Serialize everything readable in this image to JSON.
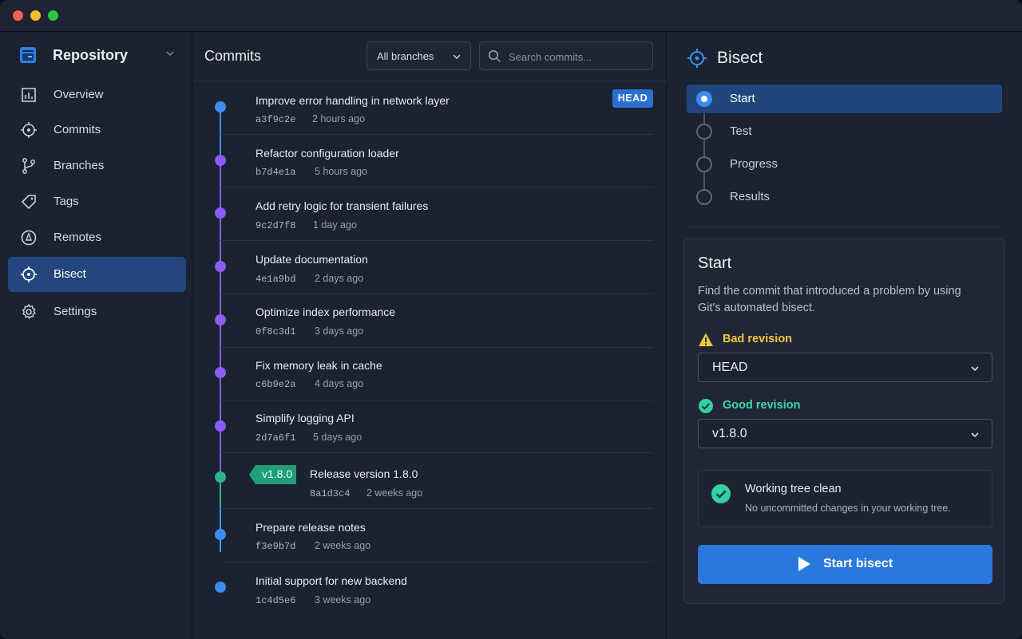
{
  "window": {
    "controls": [
      "close",
      "minimize",
      "maximize"
    ]
  },
  "sidebar": {
    "repo_title": "Repository",
    "repo_icon": "repository-icon",
    "items": [
      {
        "label": "Overview",
        "icon": "overview-icon",
        "active": false
      },
      {
        "label": "Commits",
        "icon": "commits-icon",
        "active": false
      },
      {
        "label": "Branches",
        "icon": "branches-icon",
        "active": false
      },
      {
        "label": "Tags",
        "icon": "tag-icon",
        "active": false
      },
      {
        "label": "Remotes",
        "icon": "remotes-icon",
        "active": false
      },
      {
        "label": "Bisect",
        "icon": "bisect-icon",
        "active": true
      },
      {
        "label": "Settings",
        "icon": "gear-icon",
        "active": false
      }
    ]
  },
  "commits": {
    "title": "Commits",
    "branch_filter": "All branches",
    "search_placeholder": "Search commits...",
    "head_badge": "HEAD",
    "list": [
      {
        "message": "Improve error handling in network layer",
        "hash": "a3f9c2e",
        "time": "2 hours ago",
        "badge": "HEAD"
      },
      {
        "message": "Refactor configuration loader",
        "hash": "b7d4e1a",
        "time": "5 hours ago"
      },
      {
        "message": "Add retry logic for transient failures",
        "hash": "9c2d7f8",
        "time": "1 day ago"
      },
      {
        "message": "Update documentation",
        "hash": "4e1a9bd",
        "time": "2 days ago"
      },
      {
        "message": "Optimize index performance",
        "hash": "0f8c3d1",
        "time": "3 days ago"
      },
      {
        "message": "Fix memory leak in cache",
        "hash": "c6b9e2a",
        "time": "4 days ago"
      },
      {
        "message": "Simplify logging API",
        "hash": "2d7a6f1",
        "time": "5 days ago"
      },
      {
        "message": "Release version 1.8.0",
        "hash": "8a1d3c4",
        "time": "2 weeks ago",
        "tag": "v1.8.0"
      },
      {
        "message": "Prepare release notes",
        "hash": "f3e9b7d",
        "time": "2 weeks ago"
      },
      {
        "message": "Initial support for new backend",
        "hash": "1c4d5e6",
        "time": "3 weeks ago"
      }
    ]
  },
  "bisect": {
    "title": "Bisect",
    "steps": [
      {
        "label": "Start",
        "active": true
      },
      {
        "label": "Test",
        "active": false
      },
      {
        "label": "Progress",
        "active": false
      },
      {
        "label": "Results",
        "active": false
      }
    ],
    "card": {
      "title": "Start",
      "description": "Find the commit that introduced a problem by using Git's automated bisect.",
      "bad_label": "Bad revision",
      "bad_value": "HEAD",
      "good_label": "Good revision",
      "good_value": "v1.8.0",
      "status_title": "Working tree clean",
      "status_subtitle": "No uncommitted changes in your working tree.",
      "button_label": "Start bisect"
    }
  },
  "colors": {
    "accent": "#2a78de",
    "head_dot": "#3b8ef0",
    "branch_dot": "#8b5cf6",
    "tag": "#2bb38a",
    "warning": "#f5c542",
    "success": "#34d0a3"
  }
}
